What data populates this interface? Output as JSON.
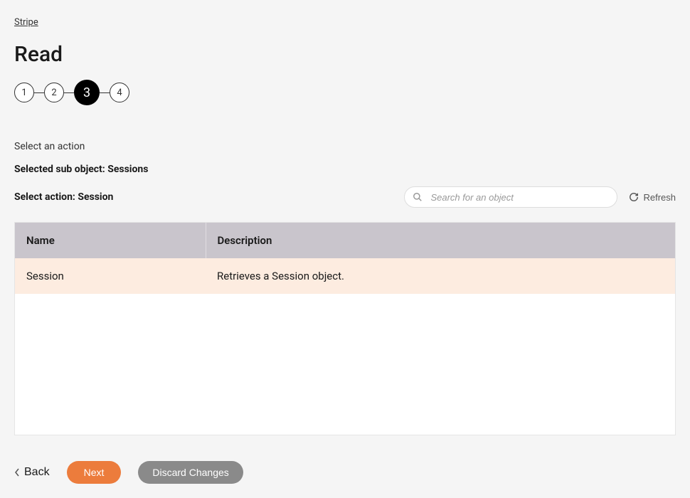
{
  "breadcrumb": "Stripe",
  "page_title": "Read",
  "stepper": {
    "steps": [
      "1",
      "2",
      "3",
      "4"
    ],
    "active_index": 2
  },
  "instruction": "Select an action",
  "selected_sub_object_label": "Selected sub object: Sessions",
  "select_action_label": "Select action: Session",
  "search": {
    "placeholder": "Search for an object"
  },
  "refresh_label": "Refresh",
  "table": {
    "headers": {
      "name": "Name",
      "description": "Description"
    },
    "rows": [
      {
        "name": "Session",
        "description": "Retrieves a Session object.",
        "selected": true
      }
    ]
  },
  "buttons": {
    "back": "Back",
    "next": "Next",
    "discard": "Discard Changes"
  }
}
